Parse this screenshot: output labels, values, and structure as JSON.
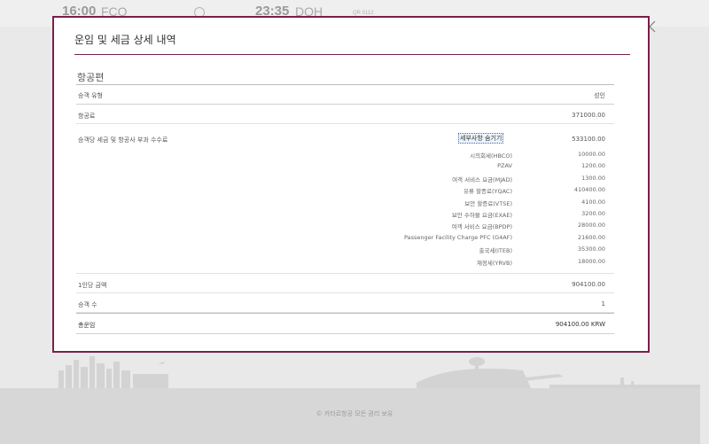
{
  "background": {
    "departure_time": "16:00",
    "departure_code": "FCO",
    "arrival_time": "23:35",
    "arrival_code": "DOH",
    "flight_no": "QR 0112",
    "copyright": "© 카타르항공 모든 권리 보유"
  },
  "modal": {
    "title": "운임 및 세금 상세 내역",
    "section_title": "항공편",
    "passenger_type_label": "승객 유형",
    "passenger_type_value": "성인",
    "fare_label": "항공료",
    "fare_value": "371000.00",
    "taxes_label": "승객당 세금 및 항공사 부과 수수료",
    "taxes_toggle": "세부사항 숨기기",
    "taxes_value": "533100.00",
    "tax_breakdown": [
      {
        "name": "시의회세(HBCO)",
        "amount": "10000.00"
      },
      {
        "name": "PZAV",
        "amount": "1200.00"
      },
      {
        "name": "여객 서비스 요금(MJAD)",
        "amount": "1300.00"
      },
      {
        "name": "유류 할증료(YQAC)",
        "amount": "410400.00"
      },
      {
        "name": "보안 할증료(VTSE)",
        "amount": "4100.00"
      },
      {
        "name": "보안 수하물 요금(EXAE)",
        "amount": "3200.00"
      },
      {
        "name": "여객 서비스 요금(BPDP)",
        "amount": "28000.00"
      },
      {
        "name": "Passenger Facility Charge PFC (G4AF)",
        "amount": "21600.00"
      },
      {
        "name": "출국세(ITEB)",
        "amount": "35300.00"
      },
      {
        "name": "재정세(YRVB)",
        "amount": "18000.00"
      }
    ],
    "per_person_label": "1인당 금액",
    "per_person_value": "904100.00",
    "passenger_count_label": "승객 수",
    "passenger_count_value": "1",
    "total_label": "총운임",
    "total_value": "904100.00 KRW"
  },
  "colors": {
    "accent": "#7a1f4a",
    "background": "#e9e9e9",
    "footer": "#d7d7d7"
  }
}
